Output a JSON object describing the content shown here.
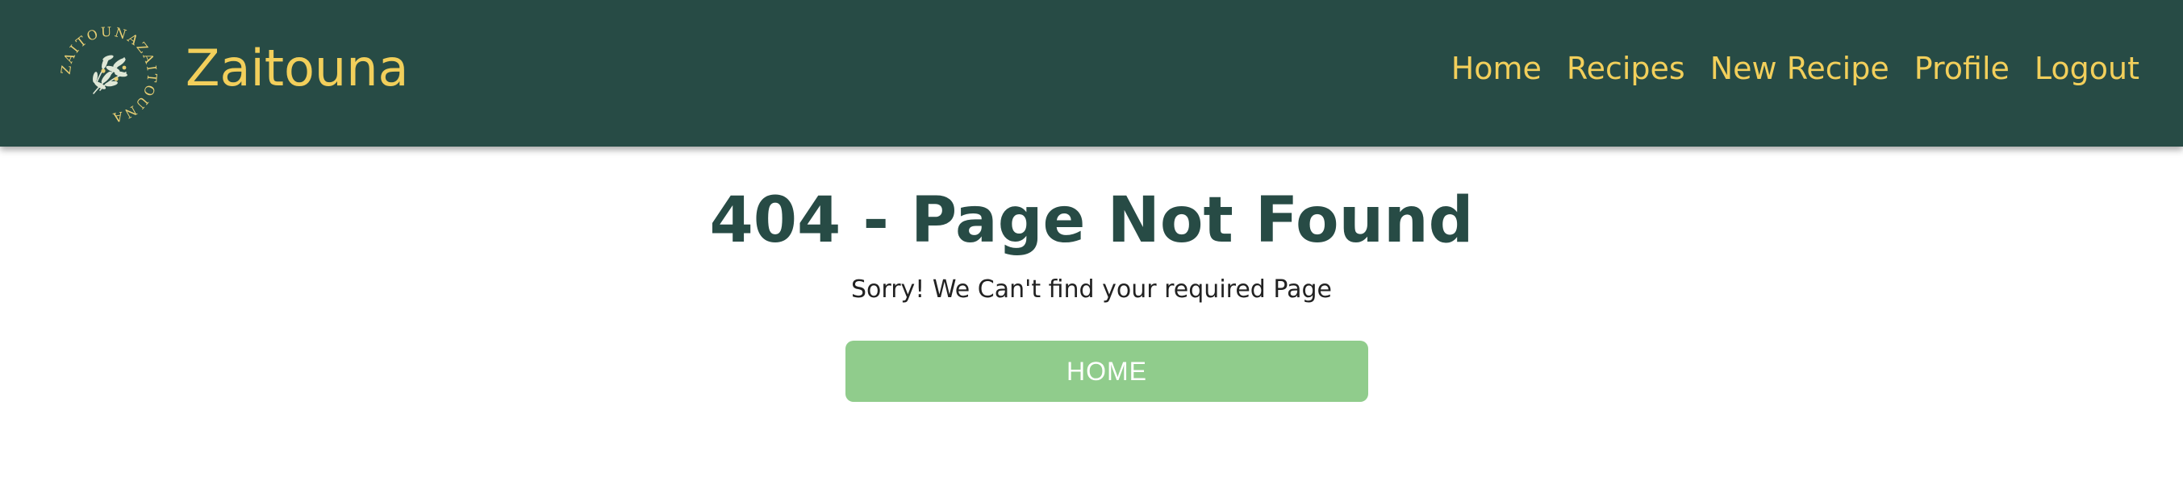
{
  "brand": {
    "name": "Zaitouna",
    "logo_ring_text": "ZAITOUNAZAITOUNA",
    "logo_icon": "olive-branch-icon"
  },
  "nav": {
    "items": [
      {
        "label": "Home"
      },
      {
        "label": "Recipes"
      },
      {
        "label": "New Recipe"
      },
      {
        "label": "Profile"
      },
      {
        "label": "Logout"
      }
    ]
  },
  "main": {
    "title": "404 - Page Not Found",
    "message": "Sorry! We Can't find your required Page",
    "home_button_label": "HOME"
  },
  "colors": {
    "navbar_bg": "#274b45",
    "accent_yellow": "#f2cf5b",
    "heading": "#274b45",
    "button_green": "#90cc8c"
  }
}
